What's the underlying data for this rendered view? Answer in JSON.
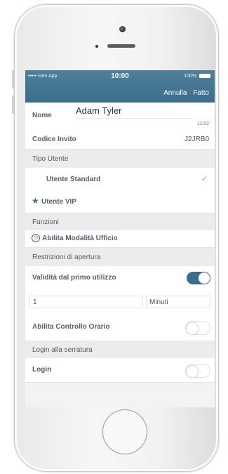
{
  "status_bar": {
    "carrier": "••••• Iseo App",
    "time": "10:00",
    "battery": "100%"
  },
  "nav": {
    "cancel": "Annulla",
    "done": "Fatto"
  },
  "form": {
    "name_label": "Nome",
    "name_value": "Adam Tyler",
    "name_counter": "11/32",
    "invite_label": "Codice Invito",
    "invite_value": "J2JRB0"
  },
  "sections": {
    "user_type": "Tipo Utente",
    "functions": "Funzioni",
    "restrictions": "Restrizioni di apertura",
    "lock_login": "Login alla serratura"
  },
  "user_types": [
    {
      "label": "Utente Standard",
      "selected": true
    },
    {
      "label": "Utente VIP",
      "icon": "star-icon",
      "selected": false
    }
  ],
  "functions": {
    "office_mode": "Abilita Modalità Ufficio"
  },
  "restrictions": {
    "validity_label": "Validità dal primo utilizzo",
    "validity_on": true,
    "duration_value": "1",
    "duration_unit": "Minuti",
    "time_control_label": "Abilita Controllo Orario",
    "time_control_on": false
  },
  "login": {
    "label": "Login",
    "on": false
  },
  "colors": {
    "accent": "#3c6e8c"
  }
}
